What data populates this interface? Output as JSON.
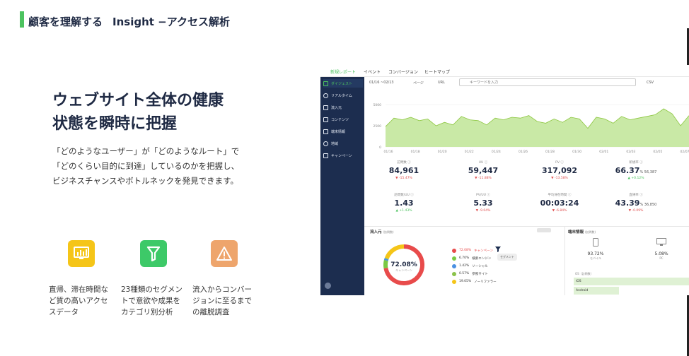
{
  "header": {
    "title_jp": "顧客を理解する",
    "title_en": "Insight −アクセス解析"
  },
  "hero": {
    "line1": "ウェブサイト全体の健康",
    "line2": "状態を瞬時に把握"
  },
  "description": {
    "line1": "「どのようなユーザー」が「どのようなルート」で",
    "line2": "「どのくらい目的に到達」しているのかを把握し、",
    "line3": "ビジネスチャンスやボトルネックを発見できます。"
  },
  "features": [
    {
      "icon": "monitor-chart-icon",
      "color": "#f5c518",
      "line1": "直帰、滞在時間な",
      "line2": "ど質の高いアクセ",
      "line3": "スデータ"
    },
    {
      "icon": "filter-icon",
      "color": "#3dc968",
      "line1": "23種類のセグメン",
      "line2": "トで意欲や成果を",
      "line3": "カテゴリ別分析"
    },
    {
      "icon": "warning-icon",
      "color": "#eea56c",
      "line1": "流入からコンバー",
      "line2": "ジョンに至るまで",
      "line3": "の離脱調査"
    }
  ],
  "dashboard": {
    "tabs": [
      "新規レポート",
      "イベント",
      "コンバージョン",
      "ヒートマップ"
    ],
    "sidebar": [
      "ダイジェスト",
      "リアルタイム",
      "流入元",
      "コンテンツ",
      "端末情報",
      "地域",
      "キャンペーン"
    ],
    "toolbar": {
      "date": "01/16 ~02/13",
      "page": "ページ",
      "url": "URL",
      "search_placeholder": "キーワードを入力",
      "csv": "CSV"
    },
    "stats": [
      {
        "label": "訪問数",
        "value": "84,961",
        "sub": "",
        "change": "-15.47%",
        "dir": "down"
      },
      {
        "label": "UU",
        "value": "59,447",
        "sub": "",
        "change": "-11.88%",
        "dir": "down"
      },
      {
        "label": "PV",
        "value": "317,092",
        "sub": "",
        "change": "-13.58%",
        "dir": "down"
      },
      {
        "label": "新規率",
        "value": "66.37",
        "sub": "% 56,387",
        "change": "+0.12%",
        "dir": "up"
      },
      {
        "label": "訪問数/UU",
        "value": "1.43",
        "sub": "",
        "change": "+1.43%",
        "dir": "up"
      },
      {
        "label": "PV/UU",
        "value": "5.33",
        "sub": "",
        "change": "-9.04%",
        "dir": "down"
      },
      {
        "label": "平均滞在時間",
        "value": "00:03:24",
        "sub": "",
        "change": "-6.84%",
        "dir": "down"
      },
      {
        "label": "直帰率",
        "value": "43.39",
        "sub": "% 36,850",
        "change": "-0.09%",
        "dir": "down"
      }
    ],
    "inflow": {
      "title": "流入元",
      "title_sub": "(訪問数)",
      "center_value": "72.08%",
      "center_label": "キャンペーン",
      "legend": [
        {
          "pct": "72.08%",
          "name": "キャンペーン",
          "color": "#e84b4b"
        },
        {
          "pct": "6.70%",
          "name": "検索エンジン",
          "color": "#7ac943"
        },
        {
          "pct": "1.42%",
          "name": "ソーシャル",
          "color": "#4a90e2"
        },
        {
          "pct": "0.57%",
          "name": "参照サイト",
          "color": "#8bc34a"
        },
        {
          "pct": "19.05%",
          "name": "ノーリファラー",
          "color": "#f5c518"
        }
      ],
      "tooltip": "セグメント"
    },
    "device": {
      "title": "端末情報",
      "title_sub": "(訪問数)",
      "mobile_pct": "93.72%",
      "mobile_label": "モバイル",
      "pc_pct": "5.08%",
      "pc_label": "PC",
      "os_title": "OS（訪問数）",
      "os": [
        "iOS",
        "Android"
      ]
    },
    "chart_data": {
      "type": "area",
      "x": [
        "01/16",
        "01/18",
        "01/20",
        "01/22",
        "01/24",
        "01/26",
        "01/28",
        "01/30",
        "02/01",
        "02/03",
        "02/05",
        "02/07"
      ],
      "values": [
        2400,
        3400,
        3200,
        3500,
        3100,
        3300,
        2500,
        2900,
        2600,
        3600,
        3200,
        3100,
        2600,
        3400,
        3200,
        3500,
        3400,
        3700,
        3000,
        2800,
        3300,
        2900,
        3500,
        3300,
        2200,
        3500,
        3300,
        2800,
        3600,
        3200,
        3400,
        3600,
        3800,
        4500,
        3900,
        2500,
        3700
      ],
      "yticks": [
        5000,
        2500,
        0
      ],
      "ylim": [
        0,
        5000
      ]
    }
  }
}
